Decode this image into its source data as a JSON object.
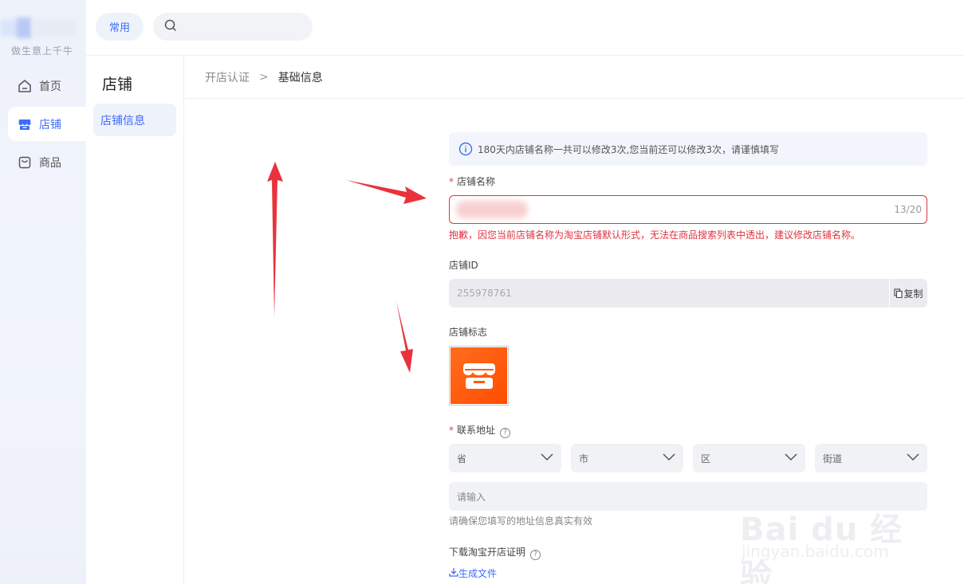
{
  "rail": {
    "logo_text": "做生意上千牛",
    "items": [
      {
        "label": "首页",
        "icon": "home-icon"
      },
      {
        "label": "店铺",
        "icon": "store-icon",
        "active": true
      },
      {
        "label": "商品",
        "icon": "product-bag-icon"
      }
    ]
  },
  "topbar": {
    "chip_label": "常用",
    "search_placeholder": ""
  },
  "subnav": {
    "title": "店铺",
    "items": [
      {
        "label": "店铺信息",
        "active": true
      }
    ]
  },
  "breadcrumb": {
    "parent": "开店认证",
    "separator": ">",
    "current": "基础信息"
  },
  "form": {
    "notice": "180天内店铺名称一共可以修改3次,您当前还可以修改3次，请谨慎填写",
    "name": {
      "required_mark": "*",
      "label": "店铺名称",
      "counter": "13/20",
      "error": "抱歉，因您当前店铺名称为淘宝店铺默认形式，无法在商品搜索列表中透出，建议修改店铺名称。"
    },
    "shop_id": {
      "label": "店铺ID",
      "value": "255978761",
      "copy_label": "复制"
    },
    "logo": {
      "label": "店铺标志"
    },
    "address": {
      "required_mark": "*",
      "label": "联系地址",
      "help_icon": "question-circle-icon",
      "selects": [
        "省",
        "市",
        "区",
        "街道"
      ],
      "detail_placeholder": "请输入",
      "hint": "请确保您填写的地址信息真实有效"
    },
    "certificate": {
      "label": "下载淘宝开店证明",
      "link_label": "生成文件"
    }
  },
  "watermark": {
    "main": "Bai du 经验",
    "sub": "jingyan.baidu.com"
  },
  "colors": {
    "accent": "#3d6dfa",
    "error": "#e0343f",
    "arrow": "#e8333c",
    "logo_orange": "#ff5a0f"
  }
}
